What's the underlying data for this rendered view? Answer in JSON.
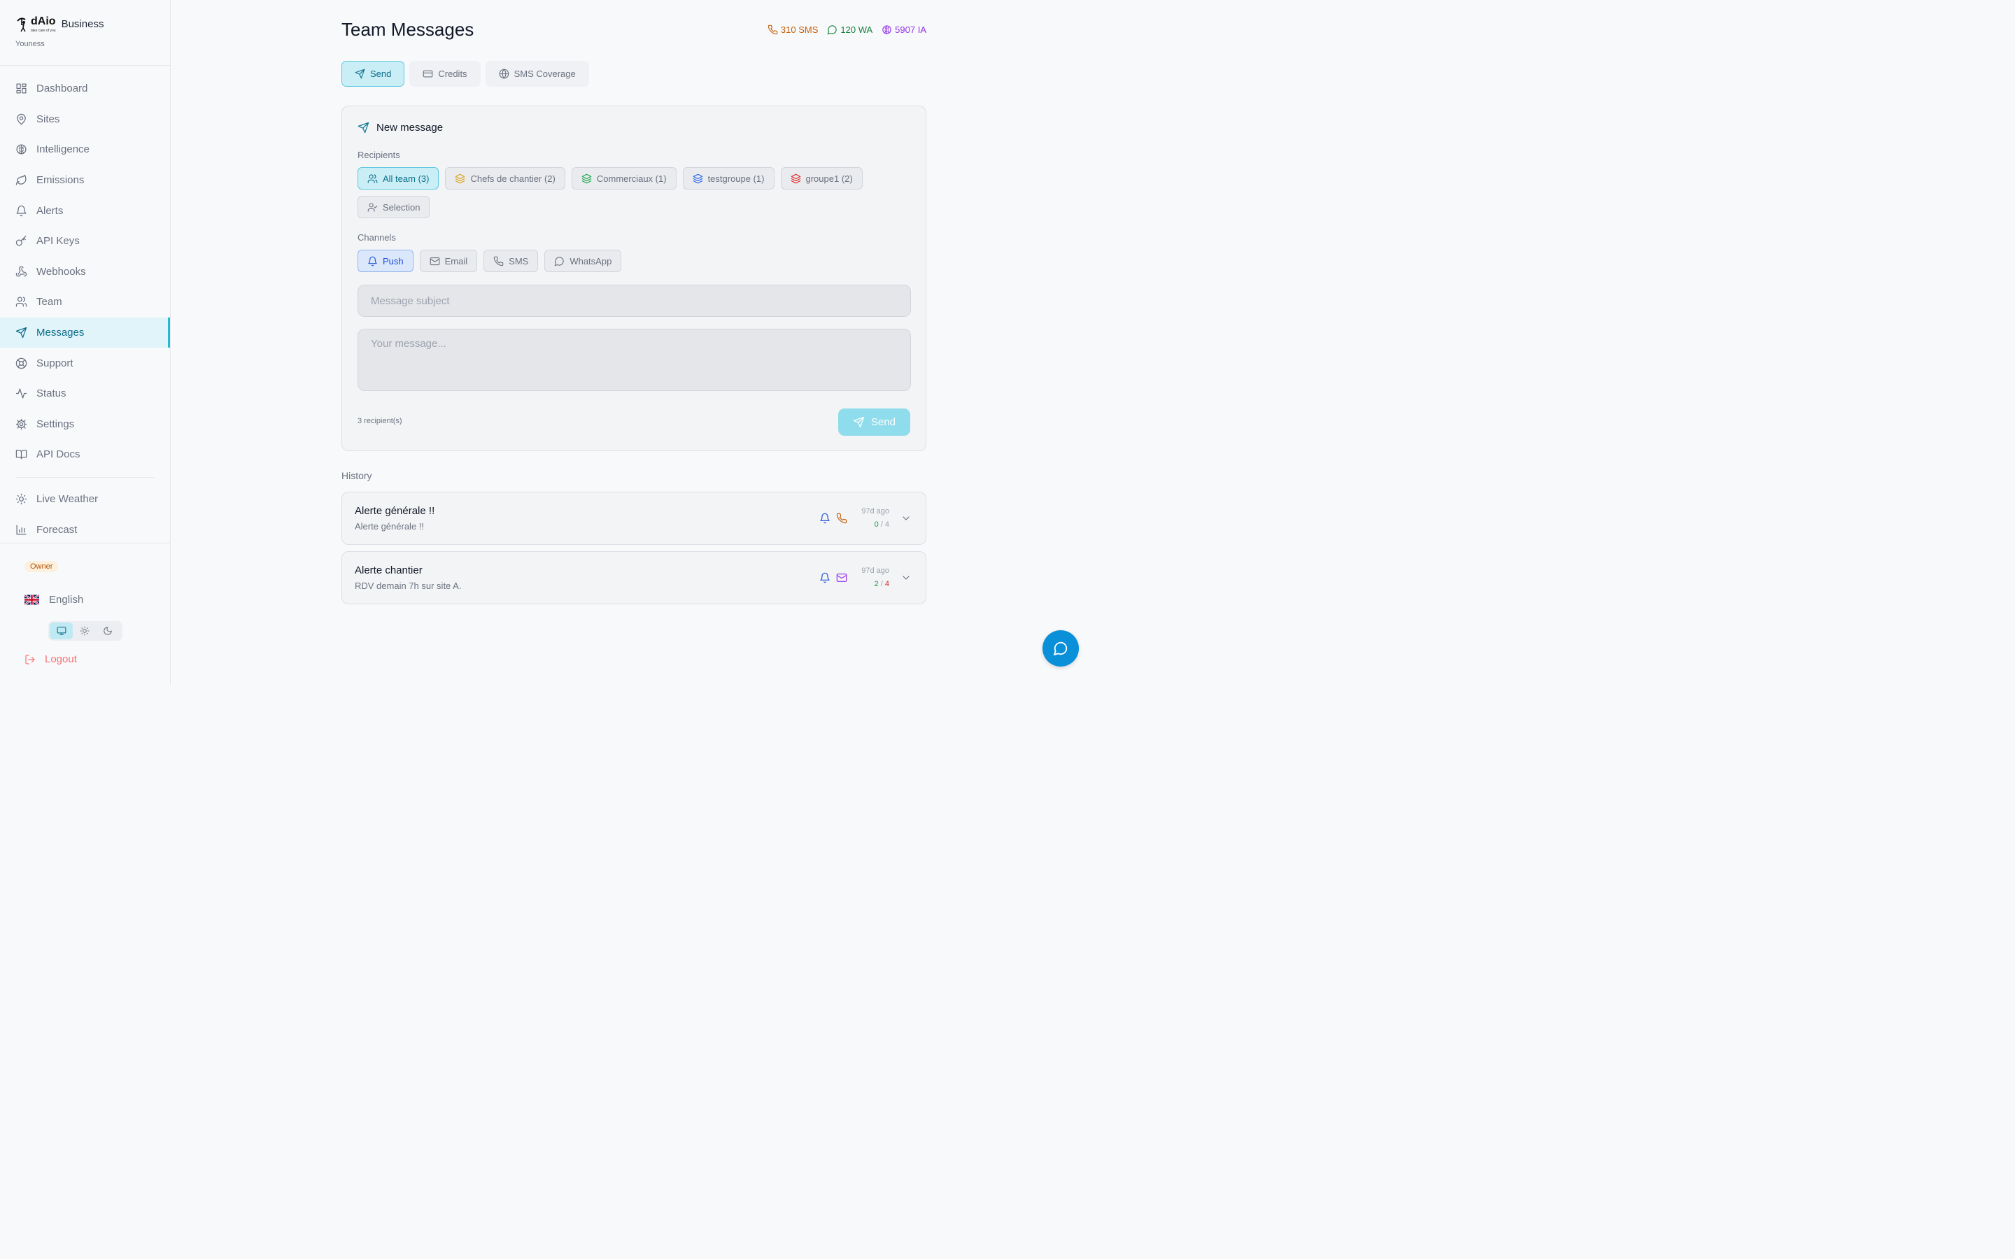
{
  "brand": {
    "logo_text": "dAio",
    "logo_tagline": "take care of you",
    "name": "Business",
    "user": "Youness"
  },
  "sidebar": {
    "items": [
      {
        "label": "Dashboard",
        "icon": "dashboard-icon"
      },
      {
        "label": "Sites",
        "icon": "map-pin-icon"
      },
      {
        "label": "Intelligence",
        "icon": "brain-icon"
      },
      {
        "label": "Emissions",
        "icon": "leaf-icon"
      },
      {
        "label": "Alerts",
        "icon": "bell-icon"
      },
      {
        "label": "API Keys",
        "icon": "key-icon"
      },
      {
        "label": "Webhooks",
        "icon": "webhook-icon"
      },
      {
        "label": "Team",
        "icon": "users-icon"
      },
      {
        "label": "Messages",
        "icon": "send-icon",
        "active": true
      },
      {
        "label": "Support",
        "icon": "life-buoy-icon"
      },
      {
        "label": "Status",
        "icon": "activity-icon"
      },
      {
        "label": "Settings",
        "icon": "gear-icon"
      },
      {
        "label": "API Docs",
        "icon": "book-icon"
      }
    ],
    "extra_items": [
      {
        "label": "Live Weather",
        "icon": "sun-icon"
      },
      {
        "label": "Forecast",
        "icon": "bar-chart-icon"
      }
    ],
    "role_badge": "Owner",
    "language": "English",
    "theme_options": [
      "system",
      "light",
      "dark"
    ],
    "theme_selected": "system",
    "logout": "Logout"
  },
  "header": {
    "title": "Team Messages",
    "credits": [
      {
        "value": "310 SMS",
        "icon": "phone-icon",
        "color": "#c2610c"
      },
      {
        "value": "120 WA",
        "icon": "chat-bubble-icon",
        "color": "#15803d"
      },
      {
        "value": "5907 IA",
        "icon": "brain-icon",
        "color": "#9333ea"
      }
    ]
  },
  "tabs": [
    {
      "label": "Send",
      "icon": "send-icon",
      "active": true
    },
    {
      "label": "Credits",
      "icon": "credit-card-icon"
    },
    {
      "label": "SMS Coverage",
      "icon": "globe-icon"
    }
  ],
  "compose": {
    "title": "New message",
    "recipients_label": "Recipients",
    "recipients": [
      {
        "label": "All team (3)",
        "icon": "users-icon",
        "active": true
      },
      {
        "label": "Chefs de chantier (2)",
        "icon": "layers-icon",
        "icon_color": "#d9a21a"
      },
      {
        "label": "Commerciaux (1)",
        "icon": "layers-icon",
        "icon_color": "#16a34a"
      },
      {
        "label": "testgroupe (1)",
        "icon": "layers-icon",
        "icon_color": "#2563eb"
      },
      {
        "label": "groupe1 (2)",
        "icon": "layers-icon",
        "icon_color": "#dc2626"
      },
      {
        "label": "Selection",
        "icon": "user-check-icon"
      }
    ],
    "channels_label": "Channels",
    "channels": [
      {
        "label": "Push",
        "icon": "bell-icon",
        "active": true
      },
      {
        "label": "Email",
        "icon": "mail-icon"
      },
      {
        "label": "SMS",
        "icon": "phone-icon"
      },
      {
        "label": "WhatsApp",
        "icon": "chat-bubble-icon"
      }
    ],
    "subject_placeholder": "Message subject",
    "message_placeholder": "Your message...",
    "recipient_count": "3 recipient(s)",
    "send_label": "Send"
  },
  "history": {
    "label": "History",
    "items": [
      {
        "title": "Alerte générale !!",
        "subtitle": "Alerte générale !!",
        "channels": [
          "bell-icon",
          "phone-icon"
        ],
        "time": "97d ago",
        "sent": "0",
        "sep": "/",
        "total": "4",
        "total_color": "#9ca3af"
      },
      {
        "title": "Alerte chantier",
        "subtitle": "RDV demain 7h sur site A.",
        "channels": [
          "bell-icon",
          "mail-icon"
        ],
        "time": "97d ago",
        "sent": "2",
        "sep": "/",
        "total": "4",
        "total_color": "#dc2626"
      }
    ]
  }
}
